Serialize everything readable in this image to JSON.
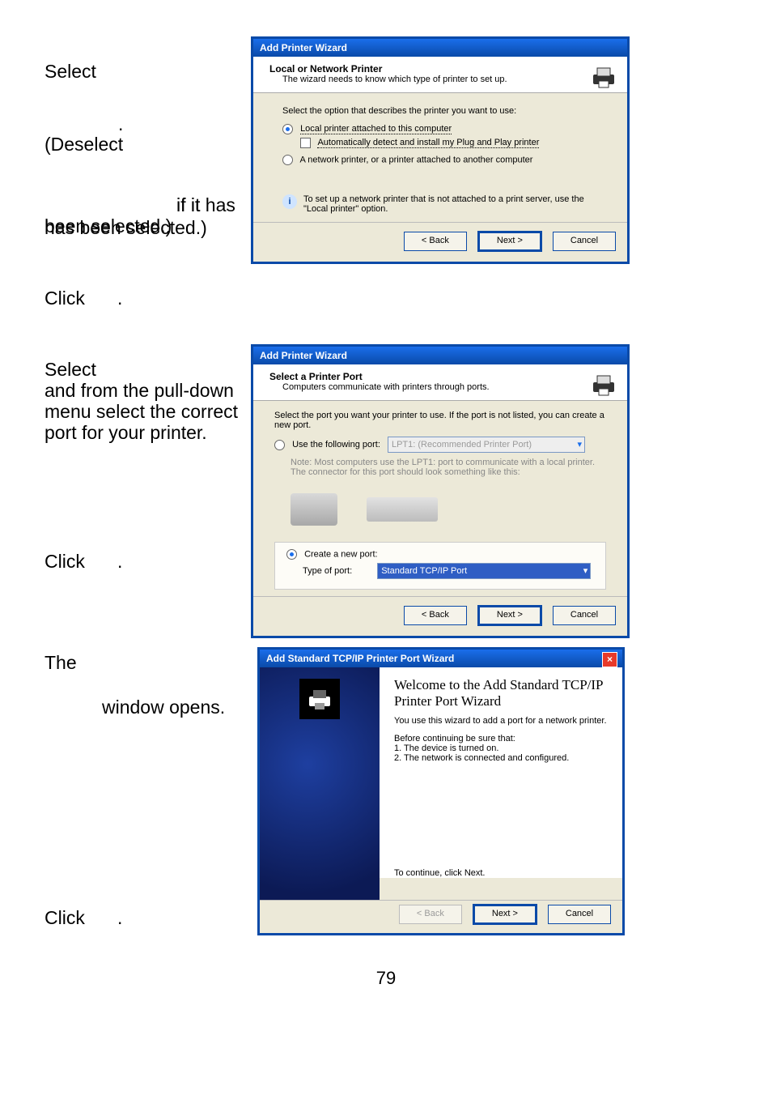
{
  "instructions": {
    "a1": "Select",
    "a2": "(Deselect",
    "a3": "if it has been selected.)",
    "a4": "Click",
    "b1": "Select",
    "b2": "and from the pull-down menu select the correct port for your printer.",
    "b3": "Click",
    "c1": "The",
    "c2": "window opens.",
    "c3": "Click",
    "dot": "."
  },
  "page_number": "79",
  "dlg1": {
    "title": "Add Printer Wizard",
    "hdr_title": "Local or Network Printer",
    "hdr_sub": "The wizard needs to know which type of printer to set up.",
    "lead": "Select the option that describes the printer you want to use:",
    "opt_local": "Local printer attached to this computer",
    "opt_auto": "Automatically detect and install my Plug and Play printer",
    "opt_net": "A network printer, or a printer attached to another computer",
    "info": "To set up a network printer that is not attached to a print server, use the \"Local printer\" option.",
    "btn_back": "< Back",
    "btn_next": "Next >",
    "btn_cancel": "Cancel"
  },
  "dlg2": {
    "title": "Add Printer Wizard",
    "hdr_title": "Select a Printer Port",
    "hdr_sub": "Computers communicate with printers through ports.",
    "lead": "Select the port you want your printer to use.  If the port is not listed, you can create a new port.",
    "opt_use": "Use the following port:",
    "dd_use": "LPT1: (Recommended Printer Port)",
    "note": "Note: Most computers use the LPT1: port to communicate with a local printer. The connector for this port should look something like this:",
    "opt_create": "Create a new port:",
    "lbl_type": "Type of port:",
    "dd_type": "Standard TCP/IP Port",
    "btn_back": "< Back",
    "btn_next": "Next >",
    "btn_cancel": "Cancel"
  },
  "dlg3": {
    "title": "Add Standard TCP/IP Printer Port Wizard",
    "welcome": "Welcome to the Add Standard TCP/IP Printer Port Wizard",
    "intro": "You use this wizard to add a port for a network printer.",
    "before": "Before continuing be sure that:",
    "pt1": "1.  The device is turned on.",
    "pt2": "2.  The network is connected and configured.",
    "cont": "To continue, click Next.",
    "btn_back": "< Back",
    "btn_next": "Next >",
    "btn_cancel": "Cancel"
  }
}
